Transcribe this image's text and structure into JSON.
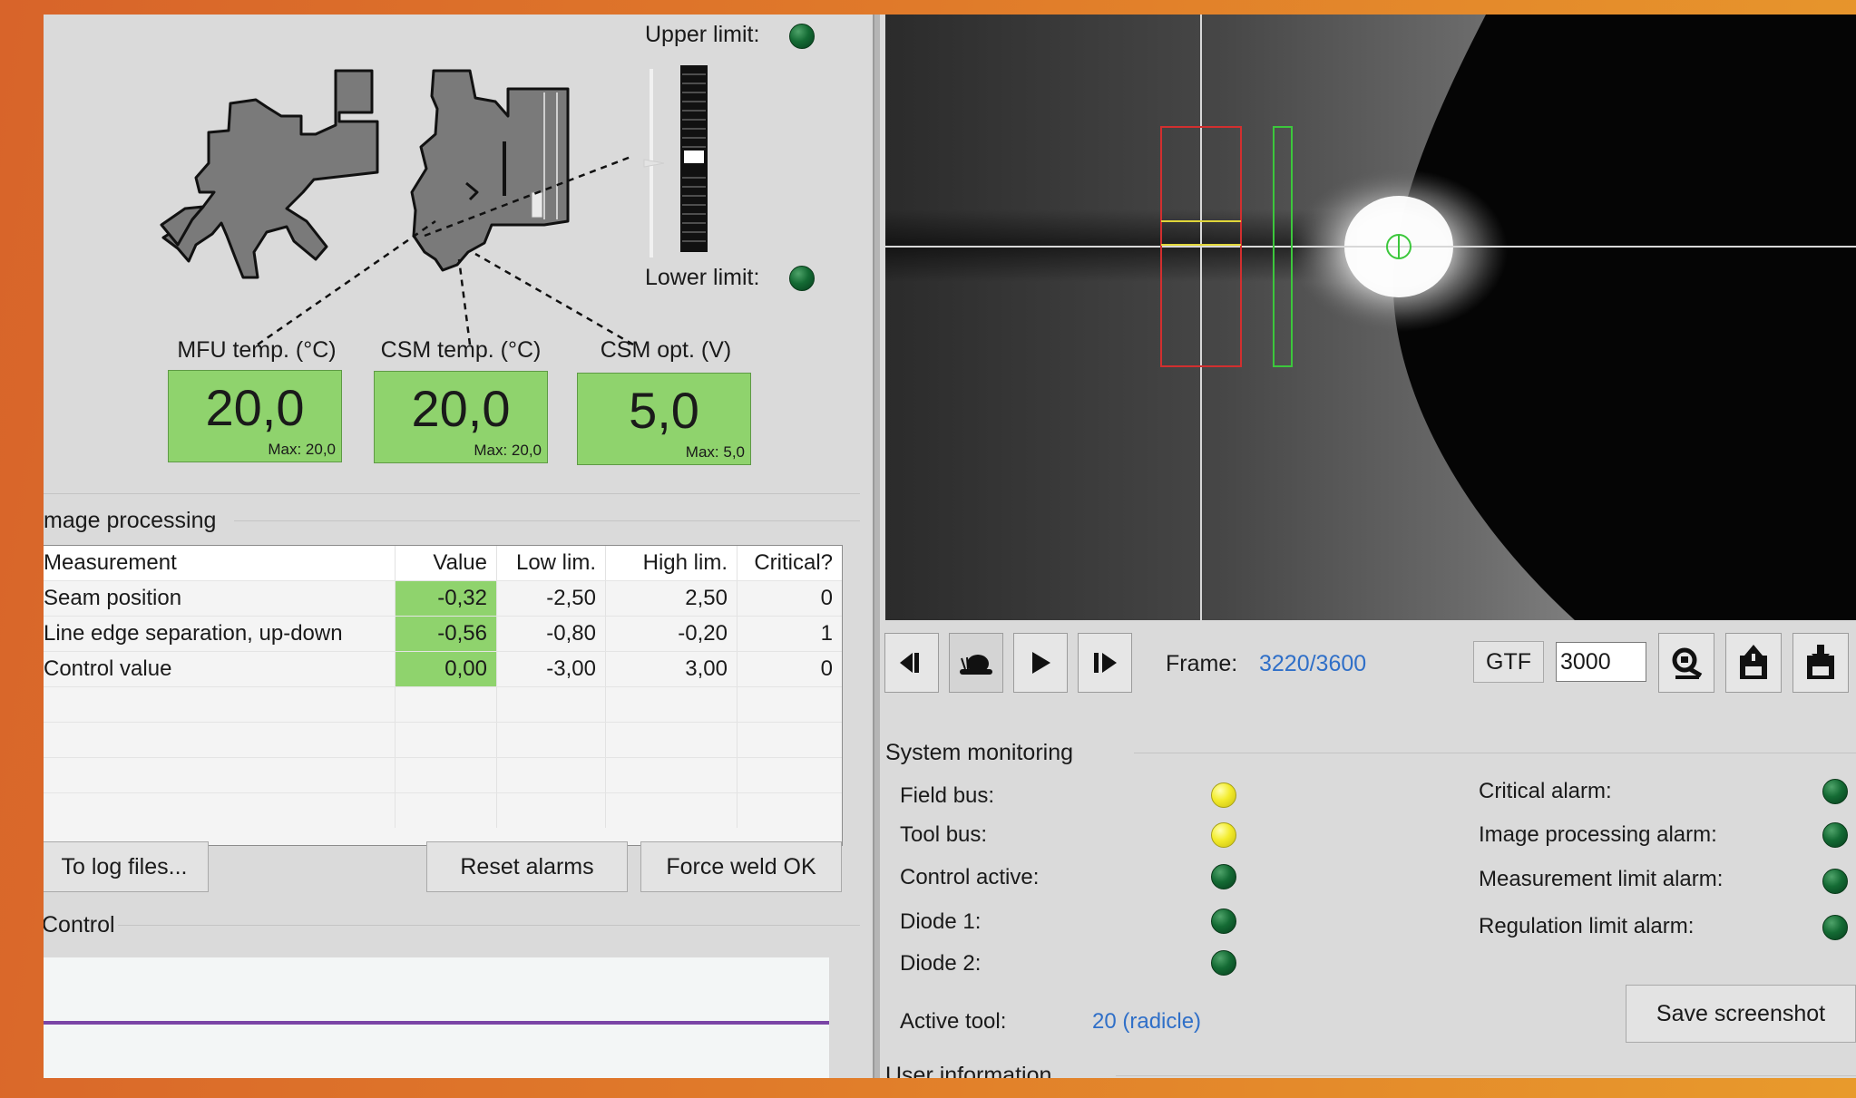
{
  "machine": {
    "upper_limit_label": "Upper limit:",
    "lower_limit_label": "Lower limit:",
    "sensors": [
      {
        "label": "MFU temp. (°C)",
        "value": "20,0",
        "max": "Max: 20,0"
      },
      {
        "label": "CSM temp.  (°C)",
        "value": "20,0",
        "max": "Max: 20,0"
      },
      {
        "label": "CSM opt. (V)",
        "value": "5,0",
        "max": "Max: 5,0"
      }
    ]
  },
  "image_processing": {
    "title": "mage processing",
    "columns": [
      "Measurement",
      "Value",
      "Low lim.",
      "High lim.",
      "Critical?"
    ],
    "rows": [
      [
        "Seam position",
        "-0,32",
        "-2,50",
        "2,50",
        "0"
      ],
      [
        "Line edge separation, up-down",
        "-0,56",
        "-0,80",
        "-0,20",
        "1"
      ],
      [
        "Control value",
        "0,00",
        "-3,00",
        "3,00",
        "0"
      ]
    ]
  },
  "buttons": {
    "log_files": "To log files...",
    "reset_alarms": "Reset alarms",
    "force_weld": "Force weld OK"
  },
  "control": {
    "title": "Control"
  },
  "playback": {
    "frame_label": "Frame:",
    "frame_value": "3220/3600",
    "gtf_label": "GTF",
    "gtf_value": "3000"
  },
  "system_monitoring": {
    "title": "System monitoring",
    "status_left": [
      {
        "label": "Field bus:",
        "color": "#f3ec2c"
      },
      {
        "label": "Tool bus:",
        "color": "#f3ec2c"
      },
      {
        "label": "Control active:",
        "color": "#146b34"
      },
      {
        "label": "Diode 1:",
        "color": "#146b34"
      },
      {
        "label": "Diode 2:",
        "color": "#146b34"
      }
    ],
    "alarms": [
      {
        "label": "Critical alarm:",
        "color": "#146b34"
      },
      {
        "label": "Image processing alarm:",
        "color": "#146b34"
      },
      {
        "label": "Measurement limit alarm:",
        "color": "#146b34"
      },
      {
        "label": "Regulation limit alarm:",
        "color": "#146b34"
      }
    ],
    "active_tool_label": "Active tool:",
    "active_tool_value": "20 (radicle)",
    "save_screenshot": "Save screenshot"
  },
  "user_information": {
    "title": "User information"
  }
}
